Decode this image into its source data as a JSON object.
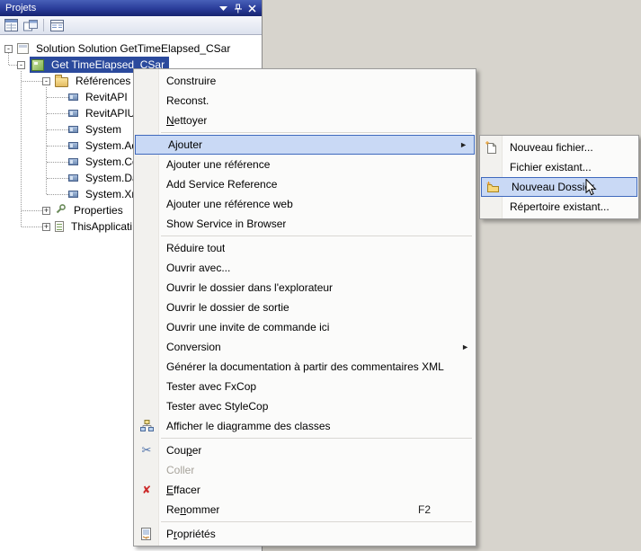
{
  "window": {
    "title": "Projets",
    "caption_buttons": [
      "window-position",
      "auto-hide-pin",
      "close"
    ]
  },
  "toolbar": {
    "icons": [
      "properties-window-icon",
      "split-panes-icon",
      "details-view-icon"
    ]
  },
  "tree": {
    "items": [
      {
        "label": "Solution Solution GetTimeElapsed_CSar",
        "expander": "-"
      },
      {
        "label": "Get TimeElapsed_CSar",
        "expander": "-",
        "selected": true
      },
      {
        "label": "Références",
        "expander": "-"
      },
      {
        "label": "RevitAPI"
      },
      {
        "label": "RevitAPIU"
      },
      {
        "label": "System"
      },
      {
        "label": "System.Ad"
      },
      {
        "label": "System.Co"
      },
      {
        "label": "System.Da"
      },
      {
        "label": "System.Xm"
      },
      {
        "label": "Properties",
        "expander": "+"
      },
      {
        "label": "ThisApplicati",
        "expander": "+"
      }
    ]
  },
  "context_menu": {
    "items": [
      {
        "label": "Construire"
      },
      {
        "label": "Reconst."
      },
      {
        "label": "Nettoyer",
        "accel": 0
      },
      {
        "separator": true
      },
      {
        "label": "Ajouter",
        "has_submenu": true,
        "highlighted": true
      },
      {
        "label": "Ajouter une référence"
      },
      {
        "label": "Add Service Reference"
      },
      {
        "label": "Ajouter une référence web"
      },
      {
        "label": "Show Service in Browser"
      },
      {
        "separator": true
      },
      {
        "label": "Réduire tout"
      },
      {
        "label": "Ouvrir avec..."
      },
      {
        "label": "Ouvrir le dossier dans l'explorateur"
      },
      {
        "label": "Ouvrir le dossier de sortie"
      },
      {
        "label": "Ouvrir une invite de commande ici"
      },
      {
        "label": "Conversion",
        "has_submenu": true
      },
      {
        "label": "Générer la documentation à partir des commentaires XML"
      },
      {
        "label": "Tester avec FxCop"
      },
      {
        "label": "Tester avec StyleCop"
      },
      {
        "label": "Afficher le diagramme des classes",
        "icon": "class-diagram-icon"
      },
      {
        "separator": true
      },
      {
        "label": "Couper",
        "accel": 3,
        "icon": "scissors-icon"
      },
      {
        "label": "Coller",
        "disabled": true
      },
      {
        "label": "Effacer",
        "accel": 0,
        "icon": "delete-icon"
      },
      {
        "label": "Renommer",
        "accel": 2,
        "shortcut": "F2"
      },
      {
        "separator": true
      },
      {
        "label": "Propriétés",
        "accel": 1,
        "icon": "properties-sheet-icon"
      }
    ]
  },
  "submenu": {
    "items": [
      {
        "label": "Nouveau fichier...",
        "icon": "new-file-icon"
      },
      {
        "label": "Fichier existant..."
      },
      {
        "label": "Nouveau Dossier",
        "icon": "new-folder-icon",
        "highlighted": true
      },
      {
        "label": "Répertoire existant..."
      }
    ]
  },
  "colors": {
    "titlebar_blue": "#2a3c99",
    "selection_blue": "#2b4a9d",
    "menu_highlight_fill": "#c9d9f5",
    "menu_highlight_border": "#3f69bd",
    "desktop_gray": "#d7d4cd"
  }
}
